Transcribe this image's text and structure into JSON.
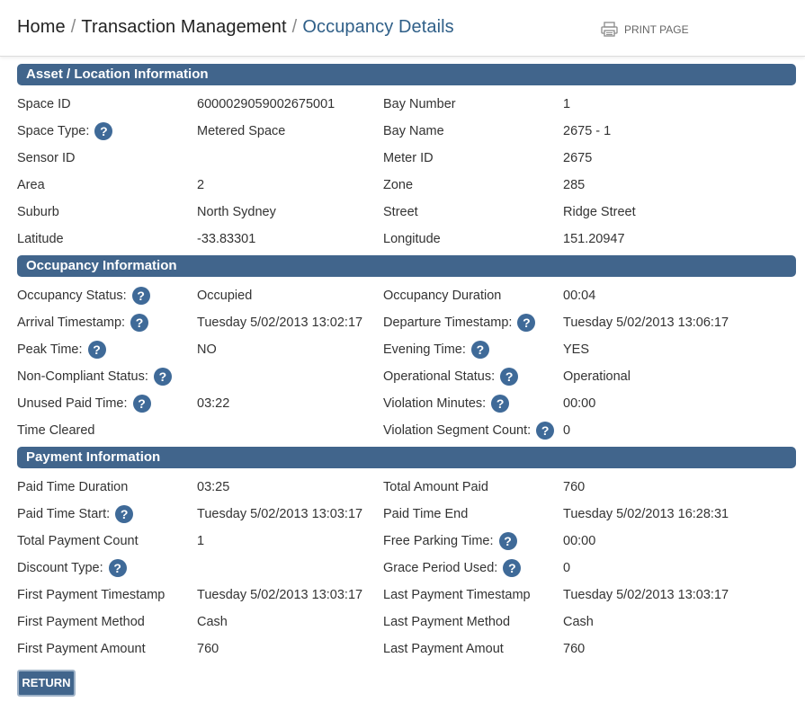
{
  "breadcrumb": {
    "home": "Home",
    "separator": "/",
    "section": "Transaction Management",
    "current": "Occupancy Details"
  },
  "print_label": "PRINT PAGE",
  "help_glyph": "?",
  "colors": {
    "section_bar": "#41658c",
    "help_icon": "#3f6a98",
    "breadcrumb_current": "#2f5f88"
  },
  "asset": {
    "title": "Asset / Location Information",
    "rows": [
      {
        "l1": "Space ID",
        "v1": "6000029059002675001",
        "l2": "Bay Number",
        "v2": "1"
      },
      {
        "l1": "Space Type:",
        "h1": true,
        "v1": "Metered Space",
        "l2": "Bay Name",
        "v2": "2675 - 1"
      },
      {
        "l1": "Sensor ID",
        "v1": "",
        "l2": "Meter ID",
        "v2": "2675"
      },
      {
        "l1": "Area",
        "v1": "2",
        "l2": "Zone",
        "v2": "285"
      },
      {
        "l1": "Suburb",
        "v1": "North Sydney",
        "l2": "Street",
        "v2": "Ridge Street"
      },
      {
        "l1": "Latitude",
        "v1": "-33.83301",
        "l2": "Longitude",
        "v2": "151.20947"
      }
    ]
  },
  "occupancy": {
    "title": "Occupancy Information",
    "rows": [
      {
        "l1": "Occupancy Status:",
        "h1": true,
        "v1": "Occupied",
        "l2": "Occupancy Duration",
        "v2": "00:04"
      },
      {
        "l1": "Arrival Timestamp:",
        "h1": true,
        "v1": "Tuesday 5/02/2013 13:02:17",
        "l2": "Departure Timestamp:",
        "h2": true,
        "v2": "Tuesday 5/02/2013 13:06:17"
      },
      {
        "l1": "Peak Time:",
        "h1": true,
        "v1": "NO",
        "l2": "Evening Time:",
        "h2": true,
        "v2": "YES"
      },
      {
        "l1": "Non-Compliant Status:",
        "h1": true,
        "v1": "",
        "l2": "Operational Status:",
        "h2": true,
        "v2": "Operational"
      },
      {
        "l1": "Unused Paid Time:",
        "h1": true,
        "v1": "03:22",
        "l2": "Violation Minutes:",
        "h2": true,
        "v2": "00:00"
      },
      {
        "l1": "Time Cleared",
        "v1": "",
        "l2": "Violation Segment Count:",
        "h2": true,
        "v2": "0"
      }
    ]
  },
  "payment": {
    "title": "Payment Information",
    "rows": [
      {
        "l1": "Paid Time Duration",
        "v1": "03:25",
        "l2": "Total Amount Paid",
        "v2": "760"
      },
      {
        "l1": "Paid Time Start:",
        "h1": true,
        "v1": "Tuesday 5/02/2013 13:03:17",
        "l2": "Paid Time End",
        "v2": "Tuesday 5/02/2013 16:28:31"
      },
      {
        "l1": "Total Payment Count",
        "v1": "1",
        "l2": "Free Parking Time:",
        "h2": true,
        "v2": "00:00"
      },
      {
        "l1": "Discount Type:",
        "h1": true,
        "v1": "",
        "l2": "Grace Period Used:",
        "h2": true,
        "v2": "0"
      },
      {
        "l1": "First Payment Timestamp",
        "v1": "Tuesday 5/02/2013 13:03:17",
        "l2": "Last Payment Timestamp",
        "v2": "Tuesday 5/02/2013 13:03:17"
      },
      {
        "l1": "First Payment Method",
        "v1": "Cash",
        "l2": "Last Payment Method",
        "v2": "Cash"
      },
      {
        "l1": "First Payment Amount",
        "v1": "760",
        "l2": "Last Payment Amout",
        "v2": "760"
      }
    ]
  },
  "return_label": "RETURN"
}
